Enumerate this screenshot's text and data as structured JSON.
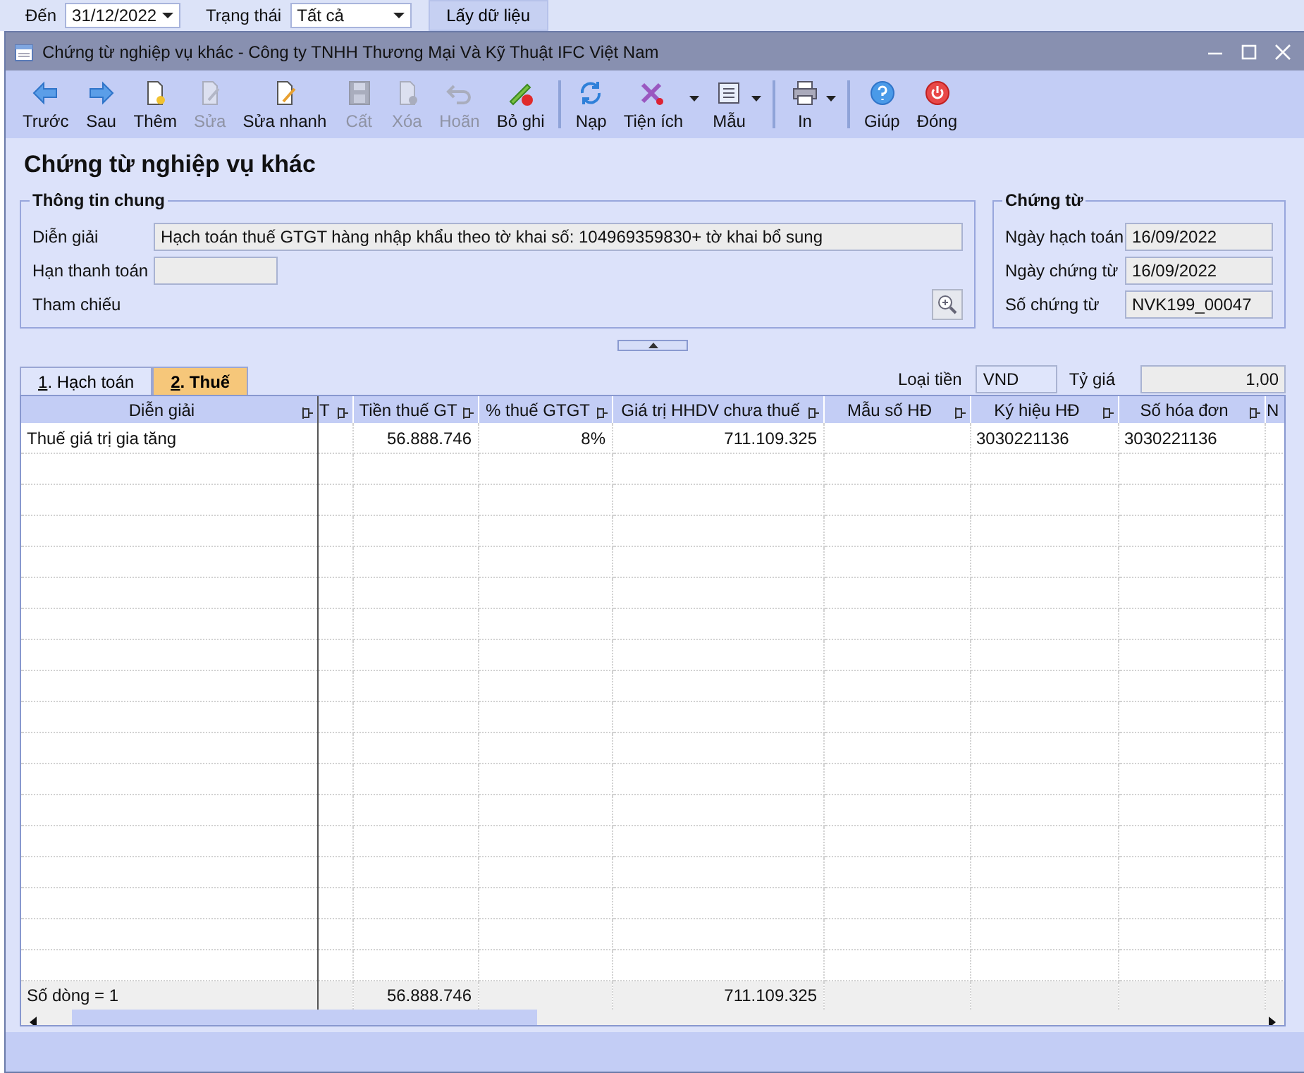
{
  "filter_bar": {
    "to_label": "Đến",
    "to_value": "31/12/2022",
    "status_label": "Trạng thái",
    "status_value": "Tất cả",
    "fetch_button": "Lấy dữ liệu"
  },
  "window": {
    "title": "Chứng từ nghiệp vụ khác - Công ty TNHH Thương Mại Và Kỹ Thuật IFC Việt Nam"
  },
  "toolbar": [
    [
      {
        "label": "Trước",
        "disabled": false,
        "dropdown": false
      },
      {
        "label": "Sau",
        "disabled": false,
        "dropdown": false
      },
      {
        "label": "Thêm",
        "disabled": false,
        "dropdown": false
      },
      {
        "label": "Sửa",
        "disabled": true,
        "dropdown": false
      },
      {
        "label": "Sửa nhanh",
        "disabled": false,
        "dropdown": false
      },
      {
        "label": "Cất",
        "disabled": true,
        "dropdown": false
      },
      {
        "label": "Xóa",
        "disabled": true,
        "dropdown": false
      },
      {
        "label": "Hoãn",
        "disabled": true,
        "dropdown": false
      },
      {
        "label": "Bỏ ghi",
        "disabled": false,
        "dropdown": false
      }
    ],
    [
      {
        "label": "Nạp",
        "disabled": false,
        "dropdown": false
      },
      {
        "label": "Tiện ích",
        "disabled": false,
        "dropdown": true
      },
      {
        "label": "Mẫu",
        "disabled": false,
        "dropdown": true
      }
    ],
    [
      {
        "label": "In",
        "disabled": false,
        "dropdown": true
      }
    ],
    [
      {
        "label": "Giúp",
        "disabled": false,
        "dropdown": false
      },
      {
        "label": "Đóng",
        "disabled": false,
        "dropdown": false
      }
    ]
  ],
  "page_title": "Chứng từ nghiệp vụ khác",
  "general_info": {
    "title": "Thông tin chung",
    "fields": [
      {
        "label": "Diễn giải",
        "value": "Hạch toán thuế GTGT hàng nhập khẩu theo tờ khai số: 104969359830+ tờ khai bổ sung"
      },
      {
        "label": "Hạn thanh toán"
      }
    ],
    "reference_label": "Tham chiếu"
  },
  "voucher": {
    "title": "Chứng từ",
    "fields": [
      {
        "label": "Ngày hạch toán",
        "value": "16/09/2022"
      },
      {
        "label": "Ngày chứng từ",
        "value": "16/09/2022"
      },
      {
        "label": "Số chứng từ",
        "value": "NVK199_00047"
      }
    ]
  },
  "tabs": [
    {
      "key": "1",
      "label": ". Hạch toán",
      "selected": false
    },
    {
      "key": "2",
      "label": ". Thuế",
      "selected": true
    }
  ],
  "currency": {
    "label": "Loại tiền",
    "value": "VND",
    "rate_label": "Tỷ giá",
    "rate_value": "1,00"
  },
  "table": {
    "columns": [
      "Diễn giải",
      "T",
      "Tiền thuế GT",
      "% thuế GTGT",
      "Giá trị HHDV chưa thuế",
      "Mẫu số HĐ",
      "Ký hiệu HĐ",
      "Số hóa đơn",
      "N"
    ],
    "rows": [
      [
        "Thuế giá trị gia tăng",
        null,
        "56.888.746",
        "8%",
        "711.109.325",
        null,
        "3030221136",
        "3030221136",
        null
      ]
    ],
    "footer": {
      "row_count": "Số dòng = 1",
      "tax_total": "56.888.746",
      "value_total": "711.109.325"
    }
  }
}
